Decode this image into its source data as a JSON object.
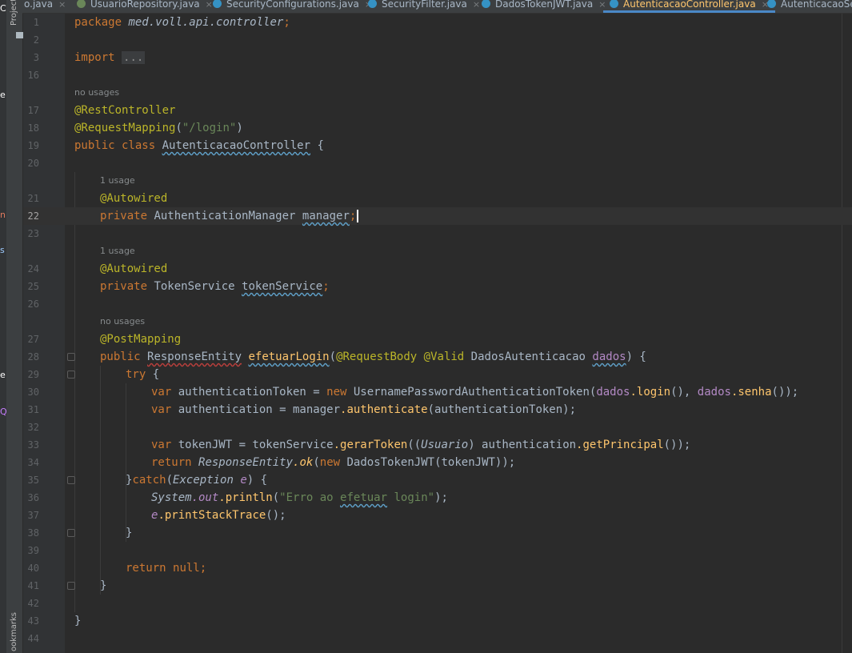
{
  "tabs": [
    {
      "label": "o.java",
      "icon": "class-icon",
      "active": false
    },
    {
      "label": "UsuarioRepository.java",
      "icon": "interface-icon",
      "active": false
    },
    {
      "label": "SecurityConfigurations.java",
      "icon": "class-icon",
      "active": false
    },
    {
      "label": "SecurityFilter.java",
      "icon": "class-icon",
      "active": false
    },
    {
      "label": "DadosTokenJWT.java",
      "icon": "record-icon",
      "active": false
    },
    {
      "label": "AutenticacaoController.java",
      "icon": "class-icon",
      "active": true
    },
    {
      "label": "AutenticacaoSer",
      "icon": "class-icon",
      "active": false
    }
  ],
  "close_glyph": "×",
  "side_labels": {
    "project": "Project",
    "bookmarks": "ookmarks"
  },
  "left_fragments": [
    "C",
    "e",
    "n",
    "s",
    "e",
    "Q"
  ],
  "hints": {
    "no_usages": "no usages",
    "one_usage": "1 usage"
  },
  "lines": [
    {
      "n": "1"
    },
    {
      "n": "2"
    },
    {
      "n": "3"
    },
    {
      "n": "16"
    },
    {
      "n": "17"
    },
    {
      "n": "18"
    },
    {
      "n": "19"
    },
    {
      "n": "20"
    },
    {
      "n": "21"
    },
    {
      "n": "22"
    },
    {
      "n": "23"
    },
    {
      "n": "24"
    },
    {
      "n": "25"
    },
    {
      "n": "26"
    },
    {
      "n": "27"
    },
    {
      "n": "28"
    },
    {
      "n": "29"
    },
    {
      "n": "30"
    },
    {
      "n": "31"
    },
    {
      "n": "32"
    },
    {
      "n": "33"
    },
    {
      "n": "34"
    },
    {
      "n": "35"
    },
    {
      "n": "36"
    },
    {
      "n": "37"
    },
    {
      "n": "38"
    },
    {
      "n": "39"
    },
    {
      "n": "40"
    },
    {
      "n": "41"
    },
    {
      "n": "42"
    },
    {
      "n": "43"
    },
    {
      "n": "44"
    }
  ],
  "code": {
    "l1_kw": "package ",
    "l1_pkg": "med.voll.api.controller",
    "l1_end": ";",
    "l3_kw": "import ",
    "l3_fold": "...",
    "l17": "@RestController",
    "l18_ann": "@RequestMapping",
    "l18_p1": "(",
    "l18_str": "\"/login\"",
    "l18_p2": ")",
    "l19_kw": "public class ",
    "l19_cls": "AutenticacaoController",
    "l19_end": " {",
    "l21": "@Autowired",
    "l22_kw": "private ",
    "l22_typ": "AuthenticationManager",
    "l22_sp": " ",
    "l22_var": "manager",
    "l22_end": ";",
    "l24": "@Autowired",
    "l25_kw": "private ",
    "l25_typ": "TokenService",
    "l25_sp": " ",
    "l25_var": "tokenService",
    "l25_end": ";",
    "l27": "@PostMapping",
    "l28_kw": "public ",
    "l28_typ": "ResponseEntity",
    "l28_sp": " ",
    "l28_meth": "efetuarLogin",
    "l28_p": "(",
    "l28_ann1": "@RequestBody",
    "l28_sp2": " ",
    "l28_ann2": "@Valid",
    "l28_sp3": " ",
    "l28_ptyp": "DadosAutenticacao",
    "l28_sp4": " ",
    "l28_par": "dados",
    "l28_end": ") {",
    "l29_kw": "try",
    "l29_end": " {",
    "l30_kw": "var ",
    "l30_a": "authenticationToken = ",
    "l30_new": "new ",
    "l30_cls": "UsernamePasswordAuthenticationToken",
    "l30_p": "(",
    "l30_d1": "dados",
    "l30_m1": ".login",
    "l30_c": "(), ",
    "l30_d2": "dados",
    "l30_m2": ".senha",
    "l30_end": "());",
    "l31_kw": "var ",
    "l31_a": "authentication = manager",
    "l31_m": ".authenticate",
    "l31_end": "(authenticationToken);",
    "l33_kw": "var ",
    "l33_a": "tokenJWT = tokenService",
    "l33_m": ".gerarToken",
    "l33_p": "((",
    "l33_cast": "Usuario",
    "l33_b": ") authentication",
    "l33_m2": ".getPrincipal",
    "l33_end": "());",
    "l34_kw": "return ",
    "l34_cls": "ResponseEntity",
    "l34_m": ".ok",
    "l34_p": "(",
    "l34_new": "new ",
    "l34_c": "DadosTokenJWT",
    "l34_end": "(tokenJWT));",
    "l35_a": "}",
    "l35_kw": "catch",
    "l35_p": "(",
    "l35_typ": "Exception",
    "l35_sp": " ",
    "l35_var": "e",
    "l35_end": ") {",
    "l36_sys": "System",
    "l36_out": ".out",
    "l36_m": ".println",
    "l36_p": "(",
    "l36_s1": "\"Erro ao ",
    "l36_s2": "efetuar",
    "l36_s3": " login\"",
    "l36_end": ");",
    "l37_var": "e",
    "l37_m": ".printStackTrace",
    "l37_end": "();",
    "l38": "}",
    "l40_kw": "return ",
    "l40_null": "null",
    "l40_end": ";",
    "l41": "}",
    "l43": "}"
  },
  "colors": {
    "keyword": "#cc7832",
    "annotation": "#bbb529",
    "string": "#6a8759",
    "method": "#ffc66d",
    "active_tab": "#ffc66d"
  }
}
